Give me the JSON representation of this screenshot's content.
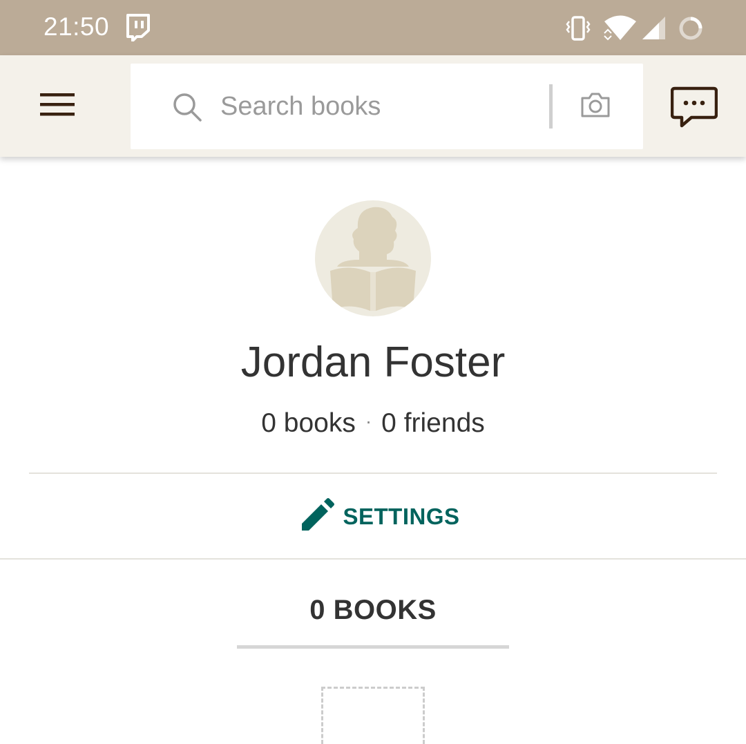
{
  "status_bar": {
    "time": "21:50",
    "icons": [
      "twitch-icon",
      "vibrate-icon",
      "wifi-icon",
      "cell-signal-icon",
      "battery-loading-icon"
    ]
  },
  "app_bar": {
    "menu_icon": "hamburger-menu-icon",
    "search": {
      "placeholder": "Search books",
      "value": "",
      "search_icon": "search-icon",
      "camera_icon": "camera-icon"
    },
    "chat_icon": "chat-bubble-icon"
  },
  "profile": {
    "name": "Jordan Foster",
    "books_count": "0 books",
    "separator": "·",
    "friends_count": "0 friends",
    "avatar_icon": "reader-silhouette-icon"
  },
  "settings": {
    "label": "SETTINGS",
    "icon": "pencil-icon"
  },
  "books_tab": {
    "label": "0 BOOKS"
  },
  "colors": {
    "status_bar": "#bbab97",
    "app_bar": "#f4f1ea",
    "accent": "#00635d",
    "icon_dark": "#382110",
    "text": "#333333"
  }
}
